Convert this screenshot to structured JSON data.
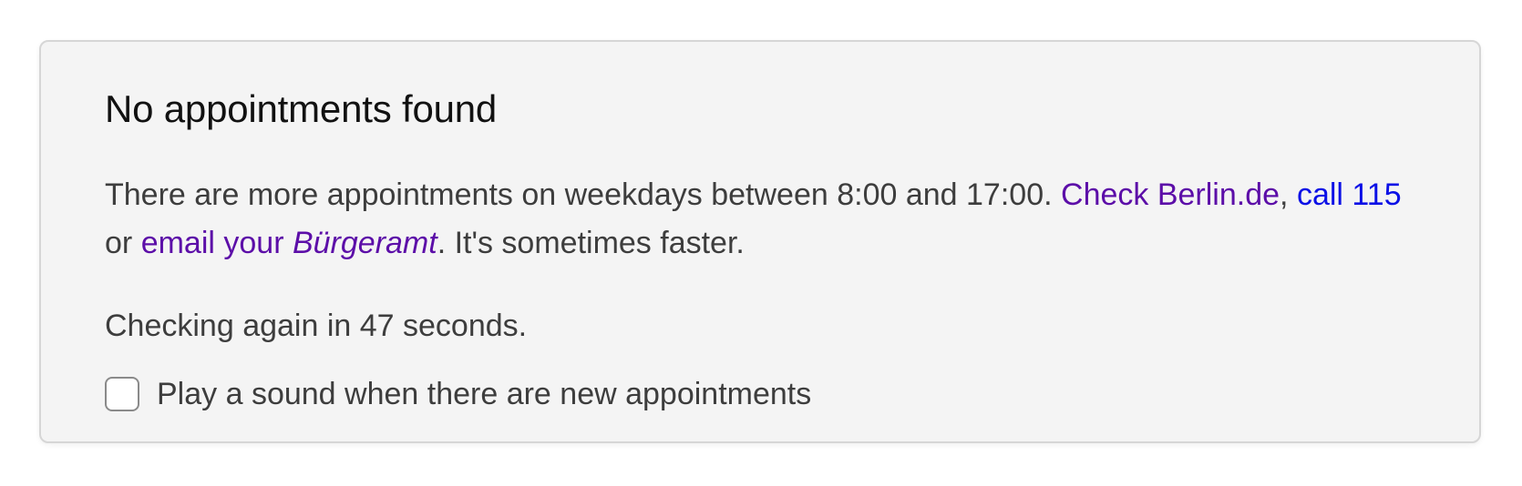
{
  "status": {
    "title": "No appointments found"
  },
  "info": {
    "text_before": "There are more appointments on weekdays between 8:00 and 17:00. ",
    "link_check_berlin": "Check Berlin.de",
    "comma": ",",
    "space": " ",
    "link_call_115": "call 115",
    "or_text": " or ",
    "link_email_prefix": "email your ",
    "link_email_italic": "Bürgeramt",
    "text_after": ". It's sometimes faster."
  },
  "countdown": {
    "text": "Checking again in 47 seconds."
  },
  "sound_option": {
    "label": "Play a sound when there are new appointments",
    "checked": false
  },
  "colors": {
    "panel_background": "#f4f4f4",
    "visited_link": "#5c0ea8",
    "unvisited_link": "#0b10e6"
  }
}
